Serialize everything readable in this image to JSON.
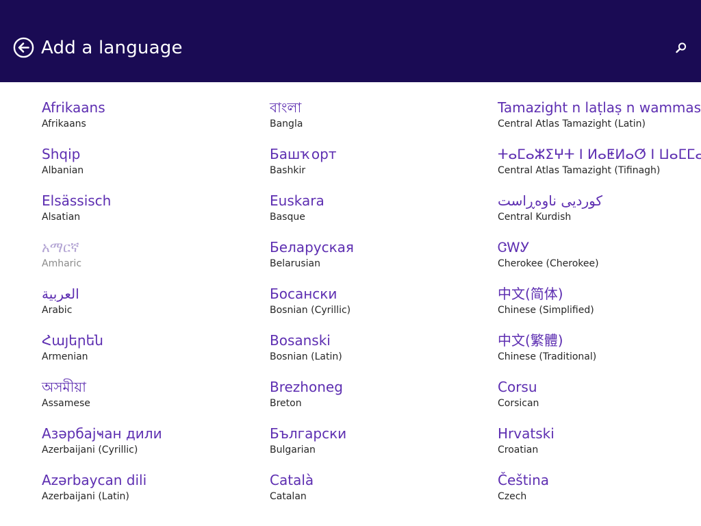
{
  "header": {
    "title": "Add a language",
    "back_icon": "back-arrow-icon",
    "search_icon": "search-icon"
  },
  "colors": {
    "header_bg": "#1a0b54",
    "accent": "#5d2eb1",
    "disabled_accent": "#b2a3d3",
    "text": "#262626"
  },
  "columns": [
    {
      "items": [
        {
          "native": "Afrikaans",
          "english": "Afrikaans",
          "enabled": true
        },
        {
          "native": "Shqip",
          "english": "Albanian",
          "enabled": true
        },
        {
          "native": "Elsässisch",
          "english": "Alsatian",
          "enabled": true
        },
        {
          "native": "አማርኛ",
          "english": "Amharic",
          "enabled": false
        },
        {
          "native": "العربية",
          "english": "Arabic",
          "enabled": true
        },
        {
          "native": "Հայերեն",
          "english": "Armenian",
          "enabled": true
        },
        {
          "native": "অসমীয়া",
          "english": "Assamese",
          "enabled": true
        },
        {
          "native": "Азәрбајҹан дили",
          "english": "Azerbaijani (Cyrillic)",
          "enabled": true
        },
        {
          "native": "Azərbaycan dili",
          "english": "Azerbaijani (Latin)",
          "enabled": true
        }
      ]
    },
    {
      "items": [
        {
          "native": "বাংলা",
          "english": "Bangla",
          "enabled": true
        },
        {
          "native": "Башҡорт",
          "english": "Bashkir",
          "enabled": true
        },
        {
          "native": "Euskara",
          "english": "Basque",
          "enabled": true
        },
        {
          "native": "Беларуская",
          "english": "Belarusian",
          "enabled": true
        },
        {
          "native": "Босански",
          "english": "Bosnian (Cyrillic)",
          "enabled": true
        },
        {
          "native": "Bosanski",
          "english": "Bosnian (Latin)",
          "enabled": true
        },
        {
          "native": "Brezhoneg",
          "english": "Breton",
          "enabled": true
        },
        {
          "native": "Български",
          "english": "Bulgarian",
          "enabled": true
        },
        {
          "native": "Català",
          "english": "Catalan",
          "enabled": true
        }
      ]
    },
    {
      "items": [
        {
          "native": "Tamazight n laṭlaṣ n wammas",
          "english": "Central Atlas Tamazight (Latin)",
          "enabled": true
        },
        {
          "native": "ⵜⴰⵎⴰⵣⵉⵖⵜ ⵏ ⵍⴰⵟⵍⴰⵚ ⵏ ⵡⴰⵎⵎⴰⵙ",
          "english": "Central Atlas Tamazight (Tifinagh)",
          "enabled": true
        },
        {
          "native": "کوردیی ناوەڕاست",
          "english": "Central Kurdish",
          "enabled": true
        },
        {
          "native": "ᏣᎳᎩ",
          "english": "Cherokee (Cherokee)",
          "enabled": true
        },
        {
          "native": "中文(简体)",
          "english": "Chinese (Simplified)",
          "enabled": true
        },
        {
          "native": "中文(繁體)",
          "english": "Chinese (Traditional)",
          "enabled": true
        },
        {
          "native": "Corsu",
          "english": "Corsican",
          "enabled": true
        },
        {
          "native": "Hrvatski",
          "english": "Croatian",
          "enabled": true
        },
        {
          "native": "Čeština",
          "english": "Czech",
          "enabled": true
        }
      ]
    }
  ]
}
